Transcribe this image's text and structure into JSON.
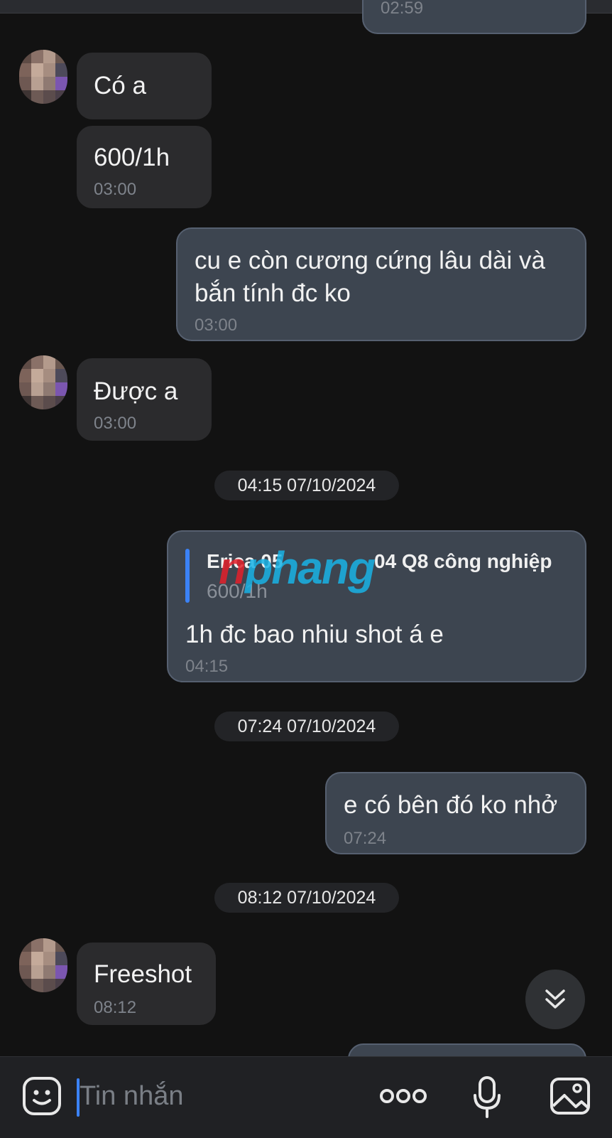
{
  "messages": [
    {
      "id": "m0",
      "time": "02:59"
    },
    {
      "id": "m1",
      "text": "Có a"
    },
    {
      "id": "m2",
      "text": "600/1h",
      "time": "03:00"
    },
    {
      "id": "m3",
      "text_line1": "cu e còn cương cứng lâu dài và",
      "text_line2": "bắn tính đc ko",
      "time": "03:00"
    },
    {
      "id": "m4",
      "text": "Được a",
      "time": "03:00"
    },
    {
      "id": "m5",
      "quote_author": "Erica 05",
      "quote_author_tail": "04 Q8 công nghiệp",
      "quote_text": "600/1h",
      "text": "1h đc bao nhiu shot á e",
      "time": "04:15"
    },
    {
      "id": "m6",
      "text": "e có bên đó ko nhở",
      "time": "07:24"
    },
    {
      "id": "m7",
      "text": "Freeshot",
      "time": "08:12"
    }
  ],
  "date_separators": [
    "04:15 07/10/2024",
    "07:24 07/10/2024",
    "08:12 07/10/2024"
  ],
  "watermark": {
    "part1": "n",
    "part2": "phang"
  },
  "composer": {
    "placeholder": "Tin nhắn"
  },
  "icons": {
    "emoji": "emoji-sticker-icon",
    "more": "more-dots-icon",
    "mic": "microphone-icon",
    "gallery": "image-gallery-icon",
    "scroll": "scroll-down-chevron-icon"
  },
  "colors": {
    "background": "#121212",
    "incoming": "#2b2b2d",
    "outgoing": "#3d4550",
    "accent": "#3b82f6"
  }
}
